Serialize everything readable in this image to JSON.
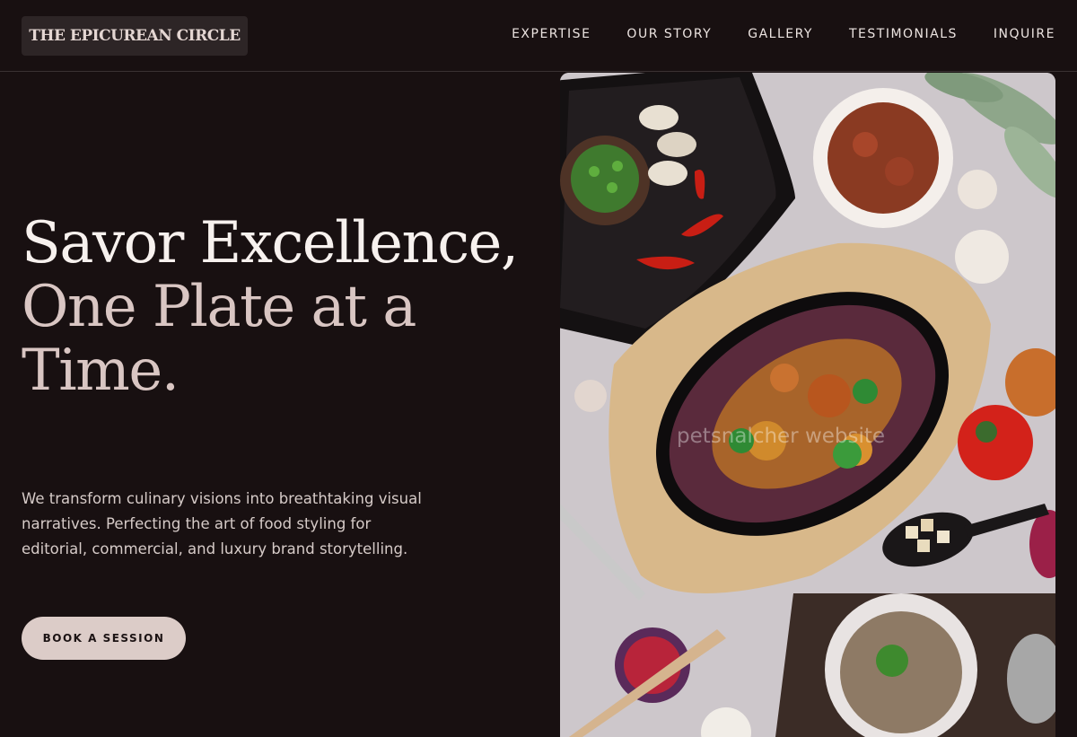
{
  "brand": {
    "name": "THE EPICUREAN CIRCLE"
  },
  "nav": {
    "items": [
      {
        "label": "EXPERTISE"
      },
      {
        "label": "OUR STORY"
      },
      {
        "label": "GALLERY"
      },
      {
        "label": "TESTIMONIALS"
      },
      {
        "label": "INQUIRE"
      }
    ]
  },
  "hero": {
    "title_line1": "Savor Excellence,",
    "title_line2": "One Plate at a Time.",
    "description": "We transform culinary visions into breathtaking visual narratives. Perfecting the art of food styling for editorial, commercial, and luxury brand storytelling.",
    "cta_label": "BOOK A SESSION"
  },
  "image": {
    "watermark": "petsnalcher website"
  },
  "colors": {
    "background": "#181011",
    "accent": "#dcccc8",
    "title_secondary": "#d9c6c3"
  }
}
